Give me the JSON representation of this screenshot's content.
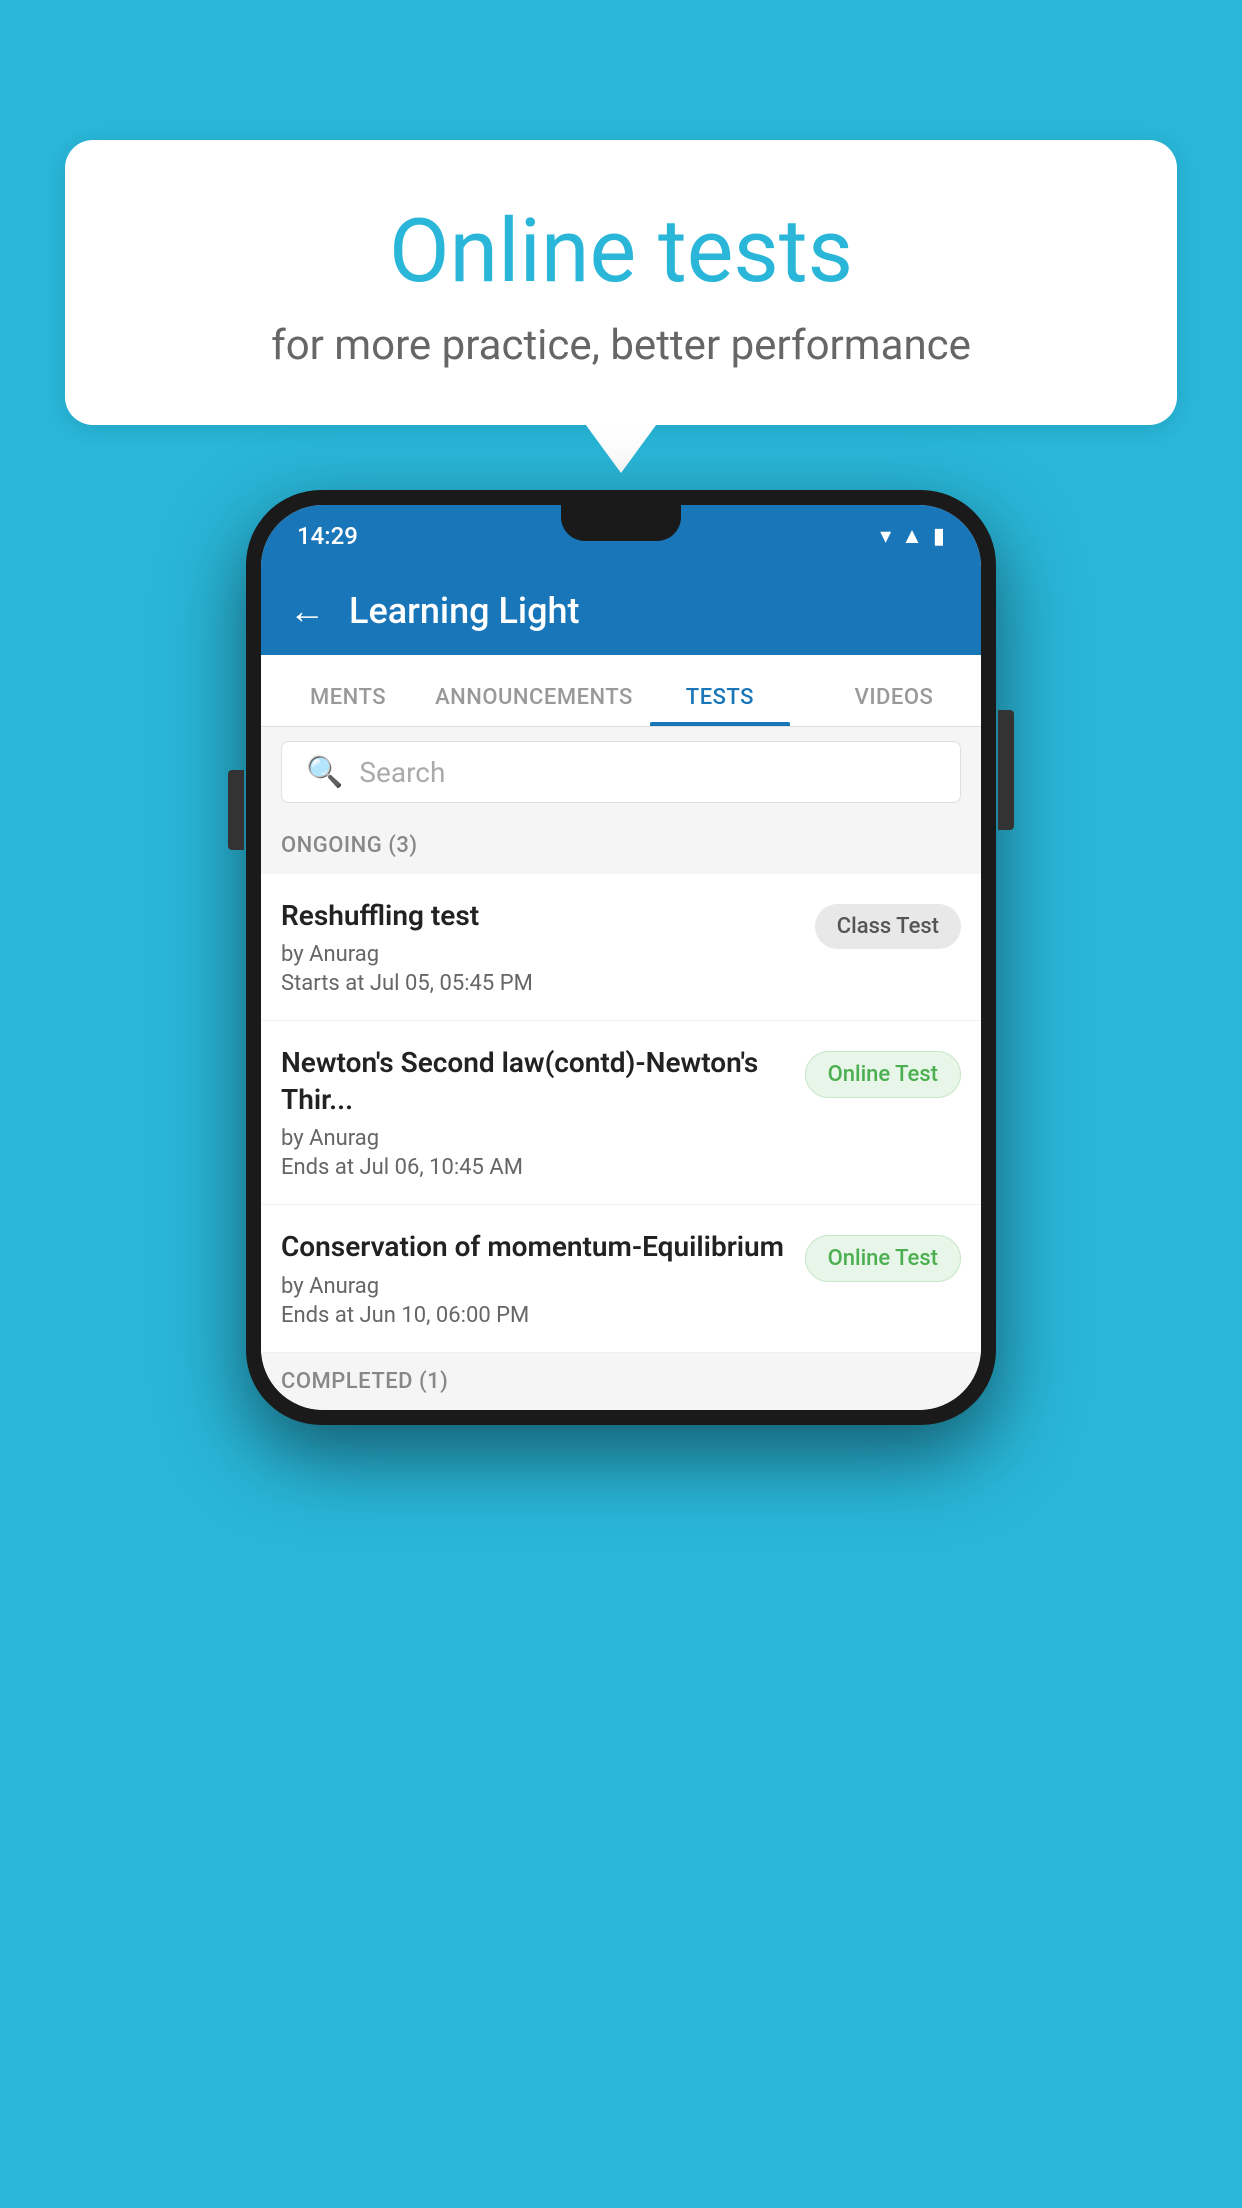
{
  "background": {
    "color": "#29b6d8"
  },
  "speech_bubble": {
    "title": "Online tests",
    "subtitle": "for more practice, better performance"
  },
  "phone": {
    "status_bar": {
      "time": "14:29",
      "icons": [
        "wifi",
        "signal",
        "battery"
      ]
    },
    "app_header": {
      "back_label": "←",
      "title": "Learning Light"
    },
    "tabs": [
      {
        "label": "MENTS",
        "active": false
      },
      {
        "label": "ANNOUNCEMENTS",
        "active": false
      },
      {
        "label": "TESTS",
        "active": true
      },
      {
        "label": "VIDEOS",
        "active": false
      }
    ],
    "search": {
      "placeholder": "Search"
    },
    "ongoing_section": {
      "label": "ONGOING (3)"
    },
    "test_items": [
      {
        "title": "Reshuffling test",
        "by": "by Anurag",
        "time_label": "Starts at",
        "time": "Jul 05, 05:45 PM",
        "badge": "Class Test",
        "badge_type": "gray"
      },
      {
        "title": "Newton's Second law(contd)-Newton's Thir...",
        "by": "by Anurag",
        "time_label": "Ends at",
        "time": "Jul 06, 10:45 AM",
        "badge": "Online Test",
        "badge_type": "green"
      },
      {
        "title": "Conservation of momentum-Equilibrium",
        "by": "by Anurag",
        "time_label": "Ends at",
        "time": "Jun 10, 06:00 PM",
        "badge": "Online Test",
        "badge_type": "green"
      }
    ],
    "completed_section": {
      "label": "COMPLETED (1)"
    }
  }
}
